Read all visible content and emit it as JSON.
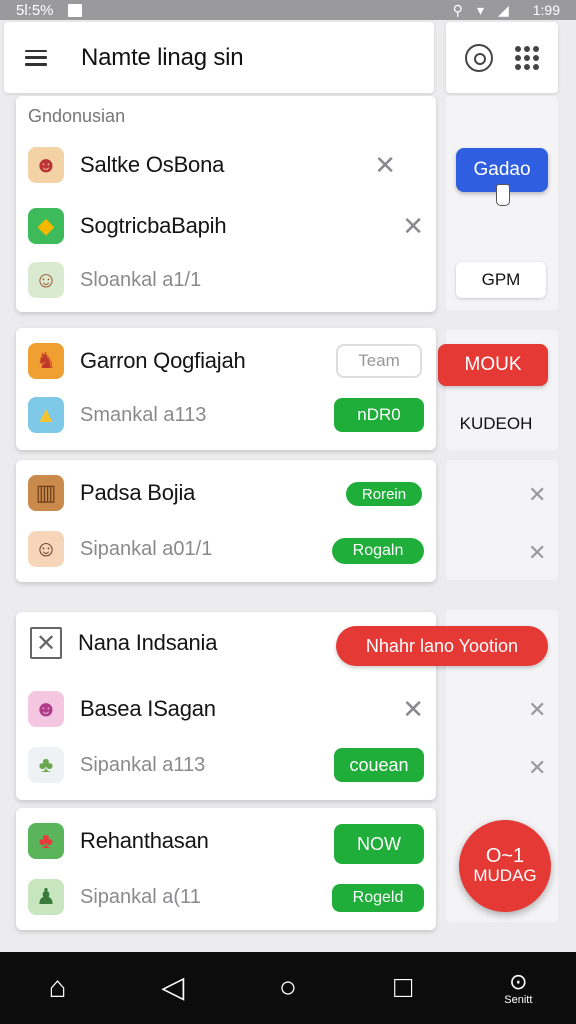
{
  "status_bar": {
    "time": "5l:5%",
    "right_text": "1:99"
  },
  "app_bar": {
    "title": "Namte linag sin"
  },
  "section1": {
    "header": "Gndonusian",
    "rows": [
      {
        "title": "Saltke OsBona",
        "icon": "game-icon"
      },
      {
        "title": "SogtricbaBapih",
        "icon": "game-icon"
      },
      {
        "subtitle": "Sloankal a1/1",
        "icon": "game-icon"
      }
    ]
  },
  "section2": {
    "rows": [
      {
        "title": "Garron Qogfiajah",
        "button": "Team"
      },
      {
        "subtitle": "Smankal a113",
        "button": "nDR0"
      }
    ]
  },
  "section3": {
    "rows": [
      {
        "title": "Padsa Bojia",
        "button": "Rorein"
      },
      {
        "subtitle": "Sipankal a01/1",
        "button": "Rogaln"
      }
    ]
  },
  "section4": {
    "rows": [
      {
        "title": "Nana Indsania"
      },
      {
        "title": "Basea ISagan"
      },
      {
        "subtitle": "Sipankal a113",
        "button": "couean"
      }
    ]
  },
  "section5": {
    "rows": [
      {
        "title": "Rehanthasan",
        "button": "NOW"
      },
      {
        "subtitle": "Sipankal a(11",
        "button": "Rogeld"
      }
    ]
  },
  "side_panel": {
    "blue_button": "Gadao",
    "gpm_button": "GPM",
    "red_button": "MOUK",
    "kudeoh_button": "KUDEOH",
    "wide_red_button": "Nhahr lano Yootion"
  },
  "fab": {
    "top": "O~1",
    "bottom": "MUDAG"
  },
  "nav_bar": {
    "search_label": "Senitt"
  },
  "colors": {
    "green": "#1fae3a",
    "red": "#e53935",
    "blue": "#2f5fe0"
  }
}
